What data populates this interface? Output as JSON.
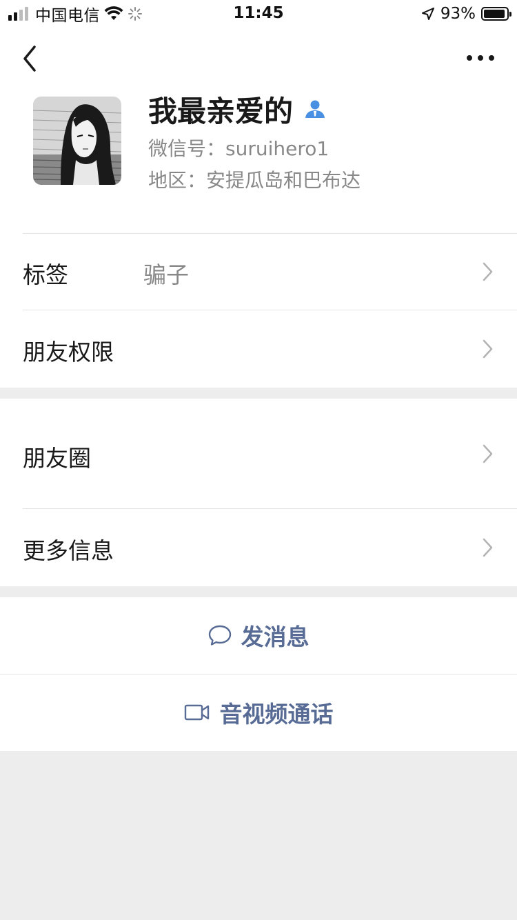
{
  "status_bar": {
    "carrier": "中国电信",
    "time": "11:45",
    "battery_percent": "93%",
    "battery_level": 0.93,
    "signal_bars_active": 2,
    "signal_bars_total": 4
  },
  "profile": {
    "name": "我最亲爱的",
    "wechat_id": "微信号：suruihero1",
    "region": "地区：安提瓜岛和巴布达"
  },
  "rows": {
    "tag_label": "标签",
    "tag_value": "骗子",
    "permissions_label": "朋友权限",
    "moments_label": "朋友圈",
    "more_info_label": "更多信息"
  },
  "actions": {
    "message_label": "发消息",
    "call_label": "音视频通话"
  },
  "colors": {
    "link_blue": "#576b95",
    "background_gray": "#ededed",
    "contact_badge_blue": "#4a90e2"
  },
  "icons": [
    "back-icon",
    "more-icon",
    "contact-badge-icon",
    "chevron-right-icon",
    "chat-bubble-icon",
    "video-camera-icon",
    "wifi-icon",
    "loading-spinner-icon",
    "location-arrow-icon",
    "battery-icon"
  ]
}
